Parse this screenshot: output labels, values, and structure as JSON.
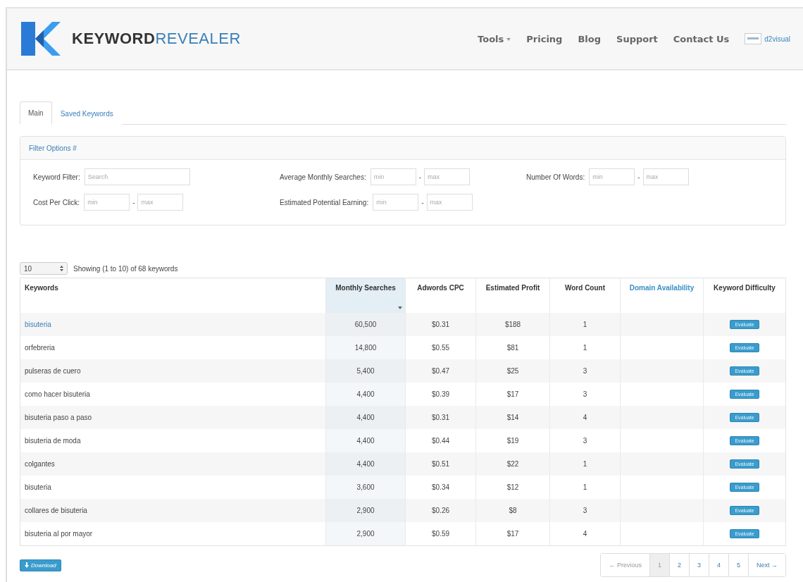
{
  "header": {
    "brand_bold": "KEYWORD",
    "brand_light": "REVEALER",
    "nav": [
      {
        "label": "Tools",
        "dropdown": true
      },
      {
        "label": "Pricing",
        "dropdown": false
      },
      {
        "label": "Blog",
        "dropdown": false
      },
      {
        "label": "Support",
        "dropdown": false
      },
      {
        "label": "Contact Us",
        "dropdown": false
      }
    ],
    "user": "d2visual"
  },
  "tabs": [
    {
      "label": "Main",
      "selected": true
    },
    {
      "label": "Saved Keywords",
      "selected": false
    }
  ],
  "filter": {
    "title": "Filter Options #",
    "separator": "-",
    "fields": [
      {
        "label": "Keyword Filter:",
        "placeholders": [
          "Search"
        ]
      },
      {
        "label": "Average Monthly Searches:",
        "placeholders": [
          "min",
          "max"
        ]
      },
      {
        "label": "Number Of Words:",
        "placeholders": [
          "min",
          "max"
        ]
      },
      {
        "label": "Cost Per Click:",
        "placeholders": [
          "min",
          "max"
        ]
      },
      {
        "label": "Estimated Potential Earning:",
        "placeholders": [
          "min",
          "max"
        ]
      }
    ]
  },
  "page_size": "10",
  "showing": "Showing (1 to 10) of 68 keywords",
  "table": {
    "columns": [
      {
        "label": "Keywords",
        "sorted": false,
        "link": false
      },
      {
        "label": "Monthly Searches",
        "sorted": true,
        "link": false
      },
      {
        "label": "Adwords CPC",
        "sorted": false,
        "link": false
      },
      {
        "label": "Estimated Profit",
        "sorted": false,
        "link": false
      },
      {
        "label": "Word Count",
        "sorted": false,
        "link": false
      },
      {
        "label": "Domain Availability",
        "sorted": false,
        "link": true
      },
      {
        "label": "Keyword Difficulty",
        "sorted": false,
        "link": false
      }
    ],
    "rows": [
      {
        "keyword": "bisuteria",
        "highlighted": true,
        "searches": "60,500",
        "cpc": "$0.31",
        "profit": "$188",
        "words": "1",
        "action": "Evaluate"
      },
      {
        "keyword": "orfebreria",
        "highlighted": false,
        "searches": "14,800",
        "cpc": "$0.55",
        "profit": "$81",
        "words": "1",
        "action": "Evaluate"
      },
      {
        "keyword": "pulseras de cuero",
        "highlighted": false,
        "searches": "5,400",
        "cpc": "$0.47",
        "profit": "$25",
        "words": "3",
        "action": "Evaluate"
      },
      {
        "keyword": "como hacer bisuteria",
        "highlighted": false,
        "searches": "4,400",
        "cpc": "$0.39",
        "profit": "$17",
        "words": "3",
        "action": "Evaluate"
      },
      {
        "keyword": "bisuteria paso a paso",
        "highlighted": false,
        "searches": "4,400",
        "cpc": "$0.31",
        "profit": "$14",
        "words": "4",
        "action": "Evaluate"
      },
      {
        "keyword": "bisuteria de moda",
        "highlighted": false,
        "searches": "4,400",
        "cpc": "$0.44",
        "profit": "$19",
        "words": "3",
        "action": "Evaluate"
      },
      {
        "keyword": "colgantes",
        "highlighted": false,
        "searches": "4,400",
        "cpc": "$0.51",
        "profit": "$22",
        "words": "1",
        "action": "Evaluate"
      },
      {
        "keyword": "bisuteria",
        "highlighted": false,
        "searches": "3,600",
        "cpc": "$0.34",
        "profit": "$12",
        "words": "1",
        "action": "Evaluate"
      },
      {
        "keyword": "collares de bisuteria",
        "highlighted": false,
        "searches": "2,900",
        "cpc": "$0.26",
        "profit": "$8",
        "words": "3",
        "action": "Evaluate"
      },
      {
        "keyword": "bisuteria al por mayor",
        "highlighted": false,
        "searches": "2,900",
        "cpc": "$0.59",
        "profit": "$17",
        "words": "4",
        "action": "Evaluate"
      }
    ]
  },
  "download": "Download",
  "pagination": [
    {
      "label": "← Previous",
      "selected": false
    },
    {
      "label": "1",
      "selected": true
    },
    {
      "label": "2",
      "selected": false
    },
    {
      "label": "3",
      "selected": false
    },
    {
      "label": "4",
      "selected": false
    },
    {
      "label": "5",
      "selected": false
    },
    {
      "label": "Next →",
      "selected": false
    }
  ]
}
